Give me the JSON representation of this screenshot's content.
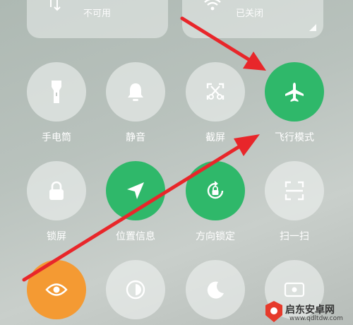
{
  "top_panels": {
    "mobile_data_status": "不可用",
    "wifi_status": "已关闭"
  },
  "tiles": [
    {
      "label": "手电筒",
      "icon": "flashlight-icon",
      "active": false
    },
    {
      "label": "静音",
      "icon": "bell-icon",
      "active": false
    },
    {
      "label": "截屏",
      "icon": "screenshot-scissors-icon",
      "active": false
    },
    {
      "label": "飞行模式",
      "icon": "airplane-icon",
      "active": true
    },
    {
      "label": "锁屏",
      "icon": "lock-icon",
      "active": false
    },
    {
      "label": "位置信息",
      "icon": "location-arrow-icon",
      "active": true
    },
    {
      "label": "方向锁定",
      "icon": "rotation-lock-icon",
      "active": true
    },
    {
      "label": "扫一扫",
      "icon": "scan-icon",
      "active": false
    },
    {
      "icon": "eye-icon",
      "active": true
    },
    {
      "icon": "contrast-icon",
      "active": false
    },
    {
      "icon": "moon-icon",
      "active": false
    },
    {
      "icon": "screen-record-icon",
      "active": false
    }
  ],
  "colors": {
    "active_green": "#2fb86a",
    "active_orange": "#f49a33",
    "annotation_red": "#e8262a"
  },
  "watermark": {
    "text": "启东安卓网",
    "url": "www.qdltdw.com"
  }
}
